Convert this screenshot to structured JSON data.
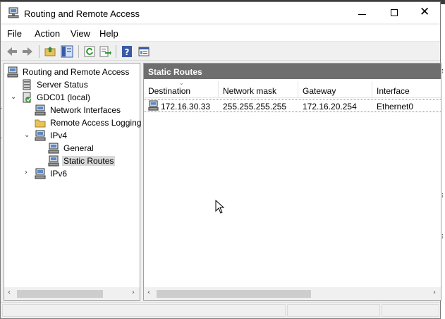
{
  "window": {
    "title": "Routing and Remote Access"
  },
  "menu": {
    "items": [
      "File",
      "Action",
      "View",
      "Help"
    ]
  },
  "toolbar": {
    "buttons": [
      "back-icon",
      "forward-icon",
      "up-folder-icon",
      "show-hide-tree-icon",
      "refresh-icon",
      "export-list-icon",
      "help-icon",
      "properties-icon"
    ]
  },
  "tree": {
    "items": [
      {
        "label": "Routing and Remote Access",
        "icon": "server-icon"
      },
      {
        "label": "Server Status",
        "icon": "server-status-icon"
      },
      {
        "label": "GDC01 (local)",
        "icon": "local-server-icon"
      },
      {
        "label": "Network Interfaces",
        "icon": "network-interfaces-icon"
      },
      {
        "label": "Remote Access Logging",
        "icon": "logging-folder-icon"
      },
      {
        "label": "IPv4",
        "icon": "ipv4-icon"
      },
      {
        "label": "General",
        "icon": "general-icon"
      },
      {
        "label": "Static Routes",
        "icon": "static-routes-icon",
        "selected": true
      },
      {
        "label": "IPv6",
        "icon": "ipv6-icon"
      }
    ]
  },
  "details": {
    "header": "Static Routes",
    "columns": [
      "Destination",
      "Network mask",
      "Gateway",
      "Interface"
    ],
    "rows": [
      {
        "destination": "172.16.30.33",
        "mask": "255.255.255.255",
        "gateway": "172.16.20.254",
        "interface": "Ethernet0"
      }
    ]
  },
  "colors": {
    "header_bg": "#6e6e6e",
    "selection": "#d9d9d9",
    "toolbar_accent": "#3a5aa5"
  }
}
